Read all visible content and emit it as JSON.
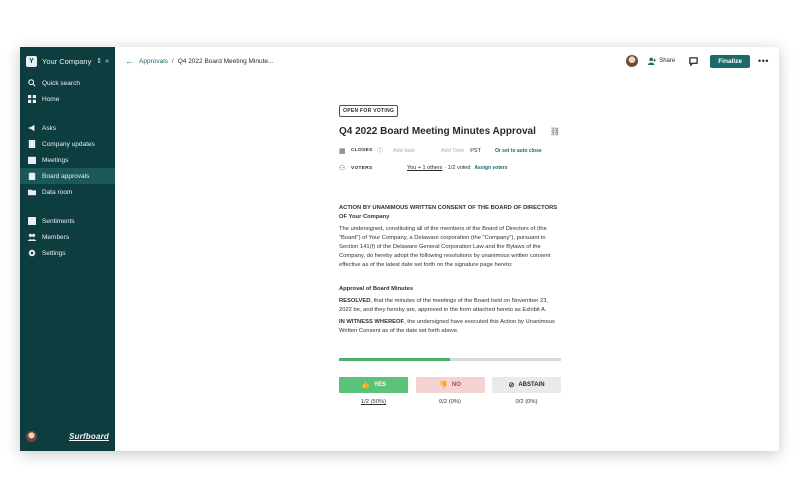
{
  "sidebar": {
    "company_initial": "Y",
    "company_name": "Your Company",
    "items": [
      {
        "label": "Quick search",
        "icon": "search-icon"
      },
      {
        "label": "Home",
        "icon": "home-icon"
      },
      {
        "label": "Asks",
        "icon": "megaphone-icon"
      },
      {
        "label": "Company updates",
        "icon": "document-icon"
      },
      {
        "label": "Meetings",
        "icon": "calendar-icon"
      },
      {
        "label": "Board approvals",
        "icon": "clipboard-icon",
        "active": true
      },
      {
        "label": "Data room",
        "icon": "folder-icon"
      },
      {
        "label": "Sentiments",
        "icon": "chart-icon"
      },
      {
        "label": "Members",
        "icon": "people-icon"
      },
      {
        "label": "Settings",
        "icon": "gear-icon"
      }
    ],
    "brand": "Surfboard"
  },
  "topbar": {
    "breadcrumb_parent": "Approvals",
    "breadcrumb_current": "Q4 2022 Board Meeting Minute...",
    "share_label": "Share",
    "finalize_label": "Finalize",
    "more_label": "•••"
  },
  "approval": {
    "status": "OPEN FOR VOTING",
    "title": "Q4 2022 Board Meeting Minutes Approval",
    "closes_label": "CLOSES",
    "add_date": "Add date",
    "add_time": "Add Time",
    "timezone": "PST",
    "auto_close": "Or set to auto close",
    "voters_label": "VOTERS",
    "voters_link": "You + 1 others",
    "voted": "· 1/2 voted",
    "assign_voters": "Assign voters"
  },
  "document": {
    "heading": "ACTION BY UNANIMOUS WRITTEN CONSENT OF THE BOARD OF DIRECTORS OF Your Company",
    "paragraph1": "The undersigned, constituting all of the members of the Board of Directors of (the \"Board\") of Your Company, a Delaware corporation (the \"Company\"), pursuant to Section 141(f) of the Delaware General Corporation Law and the Bylaws of the Company, do hereby adopt the following resolutions by unanimous written consent effective as of the latest date set forth on the signature page hereto:",
    "section_title": "Approval of Board Minutes",
    "resolved_bold": "RESOLVED",
    "resolved_text": ", that the minutes of the meetings of the Board held on November 23, 2022 be, and they hereby are, approved in the form attached hereto as Exhibit A.",
    "witness_bold": "IN WITNESS WHEREOF",
    "witness_text": ", the undersigned have executed this Action by Unanimous Written Consent as of the date set forth above."
  },
  "voting": {
    "progress_percent": 50,
    "colors": {
      "yes": "#5cc27a",
      "no": "#f6d3d3",
      "abstain": "#e8eaeb",
      "accent": "#1b6b6d",
      "sidebar": "#0e3d3f"
    },
    "yes_label": "YES",
    "no_label": "NO",
    "abstain_label": "ABSTAIN",
    "yes_count": "1/2 (50%)",
    "no_count": "0/2 (0%)",
    "abstain_count": "0/2 (0%)"
  }
}
